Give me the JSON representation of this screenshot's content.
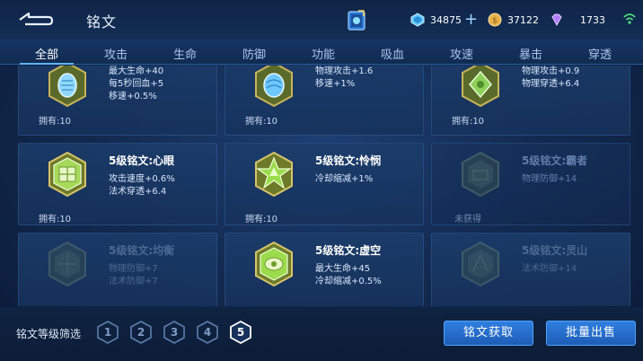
{
  "header": {
    "title": "铭文",
    "resources": [
      {
        "name": "diamond-coupon",
        "value": "34875",
        "color": "#5fc6ff"
      },
      {
        "name": "gold-coin",
        "value": "37122",
        "color": "#e7b04a"
      },
      {
        "name": "gem",
        "value": "1733",
        "color": "#b27dff"
      }
    ]
  },
  "tabs": [
    "全部",
    "攻击",
    "生命",
    "防御",
    "功能",
    "吸血",
    "攻速",
    "暴击",
    "穿透"
  ],
  "cards": [
    {
      "name": "",
      "attrs": [
        "最大生命+40",
        "每5秒回血+5",
        "移速+0.5%"
      ],
      "owned": "拥有:10",
      "gem_color": "#8fd8ff",
      "state": "owned"
    },
    {
      "name": "",
      "attrs": [
        "物理攻击+1.6",
        "移速+1%"
      ],
      "owned": "拥有:10",
      "gem_color": "#6ec8ff",
      "state": "owned"
    },
    {
      "name": "",
      "attrs": [
        "物理攻击+0.9",
        "物理穿透+6.4"
      ],
      "owned": "拥有:10",
      "gem_color": "#8fd05a",
      "state": "owned"
    },
    {
      "name": "5级铭文:心眼",
      "attrs": [
        "攻击速度+0.6%",
        "法术穿透+6.4"
      ],
      "owned": "拥有:10",
      "gem_color": "#a6d85a",
      "state": "owned"
    },
    {
      "name": "5级铭文:怜悯",
      "attrs": [
        "冷却缩减+1%"
      ],
      "owned": "拥有:10",
      "gem_color": "#9bdb4c",
      "state": "owned"
    },
    {
      "name": "5级铭文:霸者",
      "attrs": [
        "物理防御+14"
      ],
      "owned": "未获得",
      "gem_color": "#6f8f7a",
      "state": "locked"
    },
    {
      "name": "5级铭文:均衡",
      "attrs": [
        "物理防御+7",
        "法术防御+7"
      ],
      "owned": "",
      "gem_color": "#6f8f7a",
      "state": "faded"
    },
    {
      "name": "5级铭文:虚空",
      "attrs": [
        "最大生命+45",
        "冷却缩减+0.5%"
      ],
      "owned": "",
      "gem_color": "#9bdb4c",
      "state": "owned"
    },
    {
      "name": "5级铭文:灵山",
      "attrs": [
        "法术防御+14"
      ],
      "owned": "",
      "gem_color": "#6f8f7a",
      "state": "faded"
    }
  ],
  "footer": {
    "filter_label": "铭文等级筛选",
    "levels": [
      "1",
      "2",
      "3",
      "4",
      "5"
    ],
    "active_level": "5",
    "get_button": "铭文获取",
    "sell_button": "批量出售"
  }
}
